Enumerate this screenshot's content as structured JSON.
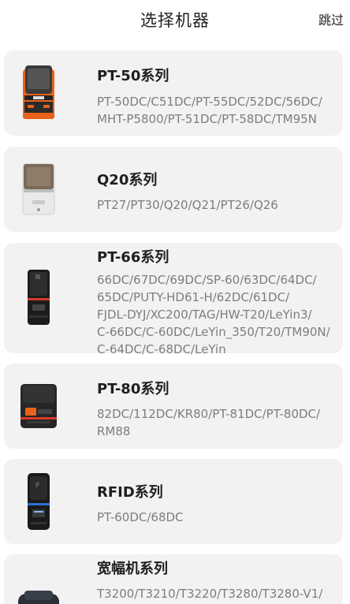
{
  "header": {
    "title": "选择机器",
    "skip_label": "跳过"
  },
  "series": [
    {
      "name": "PT-50系列",
      "models": [
        "PT-50DC/C51DC/PT-55DC/52DC/56DC/",
        "MHT-P5800/PT-51DC/PT-58DC/TM95N"
      ],
      "icon": "orange-label-printer-icon"
    },
    {
      "name": "Q20系列",
      "models": [
        "PT27/PT30/Q20/Q21/PT26/Q26"
      ],
      "icon": "grey-label-printer-icon"
    },
    {
      "name": "PT-66系列",
      "models": [
        "66DC/67DC/69DC/SP-60/63DC/64DC/",
        "65DC/PUTY-HD61-H/62DC/61DC/",
        "FJDL-DYJ/XC200/TAG/HW-T20/LeYin3/",
        "C-66DC/C-60DC/LeYin_350/T20/TM90N/",
        "C-64DC/C-68DC/LeYin"
      ],
      "icon": "handheld-printer-icon"
    },
    {
      "name": "PT-80系列",
      "models": [
        "82DC/112DC/KR80/PT-81DC/PT-80DC/",
        "RM88"
      ],
      "icon": "receipt-printer-icon"
    },
    {
      "name": "RFID系列",
      "models": [
        "PT-60DC/68DC"
      ],
      "icon": "rfid-printer-icon"
    },
    {
      "name": "宽幅机系列",
      "models": [
        "T3200/T3210/T3220/T3280/T3280-V1/"
      ],
      "icon": "wide-format-printer-icon"
    }
  ]
}
